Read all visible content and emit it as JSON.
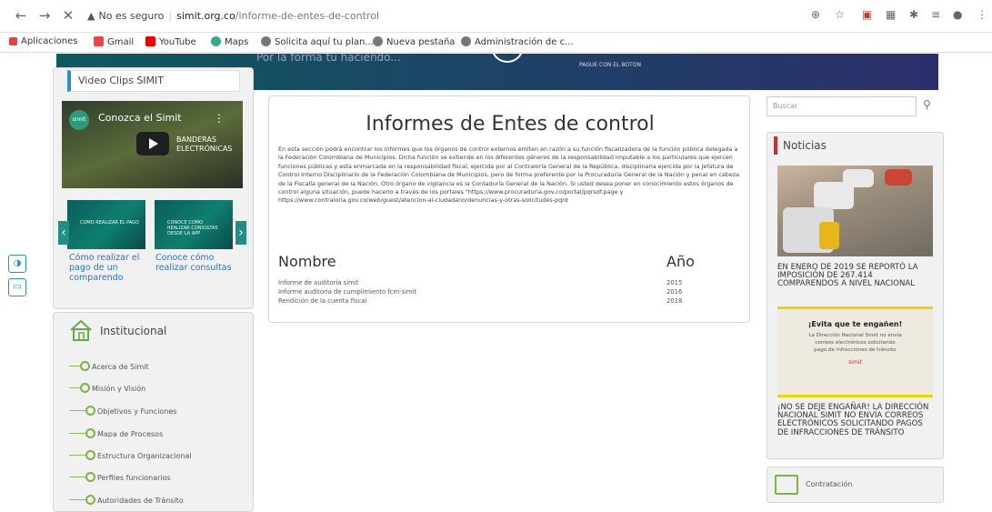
{
  "browser": {
    "url_warning": "No es seguro",
    "url_domain": "simit.org.co",
    "url_path": "/informe-de-entes-de-control",
    "bookmarks": [
      "Aplicaciones",
      "Gmail",
      "YouTube",
      "Maps",
      "Solicita aquí tu plan...",
      "Nueva pestaña",
      "Administración de c..."
    ]
  },
  "banner": {
    "text": "Por la forma tú haciendo...",
    "button_text": "PAGUE CON EL BOTON"
  },
  "video": {
    "section_title": "Video Clips SIMIT",
    "main_title": "Conozca el Simit",
    "main_subtitle": "BANDERAS ELECTRÓNICAS",
    "logo": "simit",
    "thumb1_text": "COMO REALIZAR EL PAGO",
    "thumb2_text": "CONOCE COMO REALIZAR CONSULTAS DESDE LA APP",
    "captions": [
      "Cómo realizar el pago de un comparendo",
      "Conoce cómo realizar consultas"
    ]
  },
  "institucional": {
    "title": "Institucional",
    "items": [
      "Acerca de Simit",
      "Misión y Visión",
      "Objetivos y Funciones",
      "Mapa de Procesos",
      "Estructura Organizacional",
      "Perfiles funcionarios",
      "Autoridades de Tránsito"
    ]
  },
  "content": {
    "title": "Informes de Entes de control",
    "description": "En esta sección podrá encontrar los informes que los órganos de control externos emiten en razón a su función fiscalizadora de la función pública delegada a la Federación Colombiana de Municipios. Dicha función se extiende en los diferentes géneros de la responsabilidad imputable a los particulares que ejercen funciones públicas y esta enmarcada en la responsabilidad fiscal, ejercida por al Contraloría General de la República, disciplinaria ejercida por la Jefatura de Control Interno Disciplinario de la Federación Colombiana de Municipios, pero de forma preferente por la Procuraduría General de la Nación y penal en cabeza de la Fiscalía general de la Nación. Otro órgano de vigilancia es la Contaduría General de la Nación. Si usted desea poner en conocimiento estos órganos de control alguna situación, puede hacerlo a través de los portales \"https://www.procuraduria.gov.co/portal/pqrsdf.page y https://www.contraloria.gov.co/web/guest/atencion-al-ciudadano/denuncias-y-otras-solicitudes-pqrd",
    "col_name": "Nombre",
    "col_year": "Año",
    "rows": [
      {
        "name": "Informe de auditoria simit",
        "year": "2015"
      },
      {
        "name": "Informe auditoria de cumplimiento fcm-simit",
        "year": "2016"
      },
      {
        "name": "Rendición de la cuenta fiscal",
        "year": "2018"
      }
    ]
  },
  "sidebar_right": {
    "search_placeholder": "Buscar",
    "news_title": "Noticias",
    "news1": "EN ENERO DE 2019 SE REPORTÓ LA IMPOSICIÓN DE 267.414 COMPARENDOS A NIVEL NACIONAL",
    "ad_title": "¡Evita que te engañen!",
    "ad_body": "La Dirección Nacional Simit no envía correos electrónicos solicitando pago de infracciones de tránsito",
    "ad_logo": "simit",
    "news2": "¡NO SE DEJE ENGAÑAR! LA DIRECCIÓN NACIONAL SIMIT NO ENVÍA CORREOS ELECTRÓNICOS SOLICITANDO PAGOS DE INFRACCIONES DE TRÁNSITO",
    "contratacion": "Contratación"
  }
}
